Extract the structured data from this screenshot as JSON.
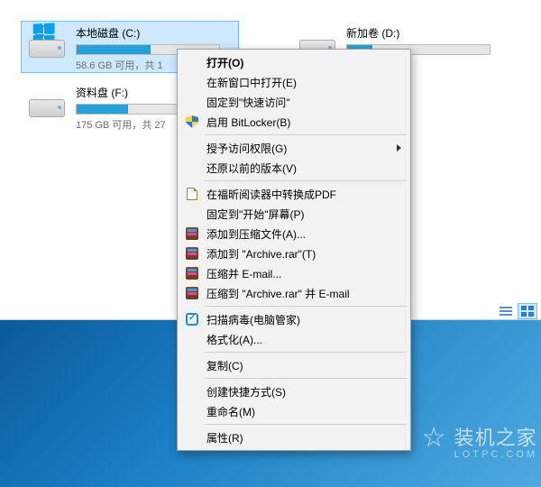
{
  "drives": [
    {
      "name": "本地磁盘 (C:)",
      "sub": "58.6 GB 可用，共 1",
      "fill": 52,
      "selected": true,
      "os": true
    },
    {
      "name": "新加卷 (D:)",
      "sub": "",
      "fill": 18,
      "selected": false,
      "os": false
    },
    {
      "name": "资料盘 (F:)",
      "sub": "175 GB 可用，共 27",
      "fill": 36,
      "selected": false,
      "os": false
    }
  ],
  "context_menu": {
    "groups": [
      [
        {
          "label": "打开(O)",
          "bold": true
        },
        {
          "label": "在新窗口中打开(E)"
        },
        {
          "label": "固定到\"快速访问\""
        },
        {
          "label": "启用 BitLocker(B)",
          "icon": "shield"
        }
      ],
      [
        {
          "label": "授予访问权限(G)",
          "submenu": true
        },
        {
          "label": "还原以前的版本(V)"
        }
      ],
      [
        {
          "label": "在福昕阅读器中转换成PDF",
          "icon": "pdf"
        },
        {
          "label": "固定到\"开始\"屏幕(P)"
        },
        {
          "label": "添加到压缩文件(A)...",
          "icon": "rar"
        },
        {
          "label": "添加到 \"Archive.rar\"(T)",
          "icon": "rar"
        },
        {
          "label": "压缩并 E-mail...",
          "icon": "rar"
        },
        {
          "label": "压缩到 \"Archive.rar\" 并 E-mail",
          "icon": "rar"
        }
      ],
      [
        {
          "label": "扫描病毒(电脑管家)",
          "icon": "scan"
        },
        {
          "label": "格式化(A)..."
        }
      ],
      [
        {
          "label": "复制(C)"
        }
      ],
      [
        {
          "label": "创建快捷方式(S)"
        },
        {
          "label": "重命名(M)"
        }
      ],
      [
        {
          "label": "属性(R)"
        }
      ]
    ]
  },
  "watermark": {
    "main": "装机之家",
    "sub": "LOTPC.COM"
  }
}
